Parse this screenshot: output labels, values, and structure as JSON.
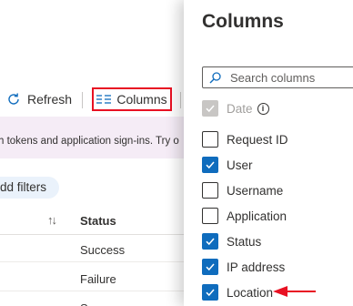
{
  "toolbar": {
    "refresh_label": "Refresh",
    "columns_label": "Columns"
  },
  "banner": {
    "text": "h tokens and application sign-ins. Try o"
  },
  "filters": {
    "add_label": "dd filters"
  },
  "table": {
    "sort_glyph": "↑↓",
    "status_header": "Status",
    "rows": [
      {
        "status": "Success"
      },
      {
        "status": "Failure"
      },
      {
        "status": "S"
      }
    ]
  },
  "panel": {
    "title": "Columns",
    "search_placeholder": "Search columns",
    "options": [
      {
        "label": "Date",
        "checked": true,
        "disabled": true,
        "info": true
      },
      {
        "label": "Request ID",
        "checked": false
      },
      {
        "label": "User",
        "checked": true
      },
      {
        "label": "Username",
        "checked": false
      },
      {
        "label": "Application",
        "checked": false
      },
      {
        "label": "Status",
        "checked": true
      },
      {
        "label": "IP address",
        "checked": true
      },
      {
        "label": "Location",
        "checked": true
      }
    ],
    "info_glyph": "i"
  },
  "colors": {
    "accent": "#0f6cbd",
    "highlight_border": "#e81123",
    "arrow": "#e81123",
    "banner_bg": "#f5ecf6",
    "filter_pill_bg": "#eaf2fb"
  },
  "icons": {
    "refresh": "refresh-icon",
    "columns": "columns-icon",
    "search": "search-icon",
    "info": "info-icon",
    "checkmark": "checkmark-icon"
  }
}
